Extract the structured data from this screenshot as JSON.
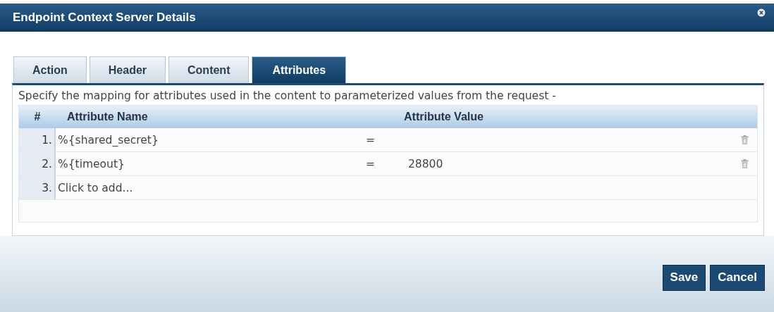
{
  "window": {
    "title": "Endpoint Context Server Details"
  },
  "tabs": [
    {
      "label": "Action",
      "selected": false
    },
    {
      "label": "Header",
      "selected": false
    },
    {
      "label": "Content",
      "selected": false
    },
    {
      "label": "Attributes",
      "selected": true
    }
  ],
  "description": "Specify the mapping for attributes used in the content to parameterized values from the request -",
  "table": {
    "columns": [
      "#",
      "Attribute Name",
      "Attribute Value"
    ],
    "rows": [
      {
        "kind": "attribute",
        "index": "1.",
        "name": "%{shared_secret}",
        "operator": "=",
        "value": ""
      },
      {
        "kind": "attribute",
        "index": "2.",
        "name": "%{timeout}",
        "operator": "=",
        "value": "28800"
      },
      {
        "kind": "add",
        "index": "3.",
        "name": "Click to add..."
      }
    ]
  },
  "buttons": [
    "Save",
    "Cancel"
  ]
}
